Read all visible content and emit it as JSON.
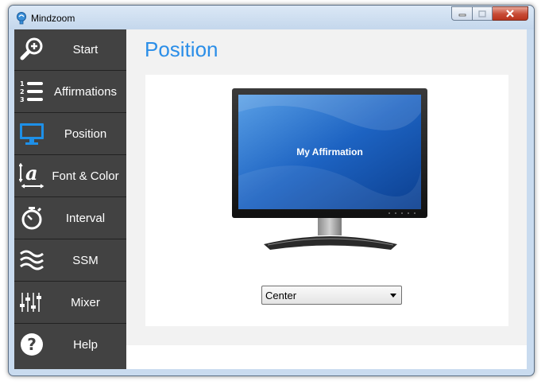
{
  "window": {
    "title": "Mindzoom"
  },
  "sidebar": {
    "items": [
      {
        "label": "Start",
        "icon": "magnifier-plus-icon"
      },
      {
        "label": "Affirmations",
        "icon": "numbered-list-icon"
      },
      {
        "label": "Position",
        "icon": "monitor-icon",
        "selected": true
      },
      {
        "label": "Font & Color",
        "icon": "font-icon"
      },
      {
        "label": "Interval",
        "icon": "stopwatch-icon"
      },
      {
        "label": "SSM",
        "icon": "waves-icon"
      },
      {
        "label": "Mixer",
        "icon": "sliders-icon"
      },
      {
        "label": "Help",
        "icon": "question-icon"
      }
    ]
  },
  "main": {
    "title": "Position",
    "preview": {
      "screen_text": "My Affirmation"
    },
    "position_select": {
      "value": "Center"
    }
  },
  "colors": {
    "accent": "#2b8ee8",
    "sidebar_bg": "#424242",
    "selected_icon": "#1e90e8"
  }
}
